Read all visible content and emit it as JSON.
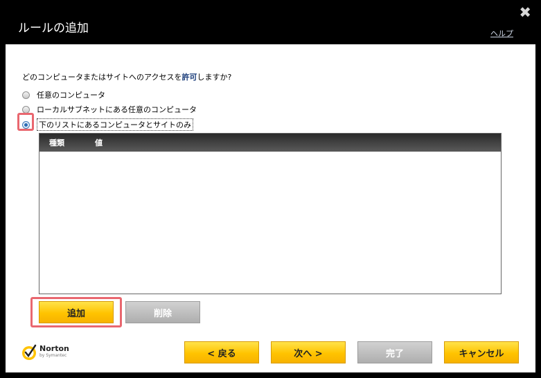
{
  "window": {
    "title": "ルールの追加",
    "help_label": "ヘルプ",
    "close_glyph": "✖"
  },
  "question": {
    "prefix": "どのコンピュータまたはサイトへのアクセスを",
    "emphasis": "許可",
    "suffix": "しますか?"
  },
  "options": [
    {
      "label": "任意のコンピュータ",
      "selected": false
    },
    {
      "label": "ローカルサブネットにある任意のコンピュータ",
      "selected": false
    },
    {
      "label": "下のリストにあるコンピュータとサイトのみ",
      "selected": true
    }
  ],
  "table": {
    "columns": [
      "種類",
      "値"
    ],
    "rows": []
  },
  "buttons": {
    "add": "追加",
    "remove": "削除",
    "back": "< 戻る",
    "next": "次へ >",
    "finish": "完了",
    "cancel": "キャンセル"
  },
  "logo": {
    "name": "Norton",
    "sub": "by Symantec"
  },
  "colors": {
    "accent_yellow": "#ffc300",
    "highlight": "#e9676f",
    "emphasis_text": "#1a3c7a"
  }
}
